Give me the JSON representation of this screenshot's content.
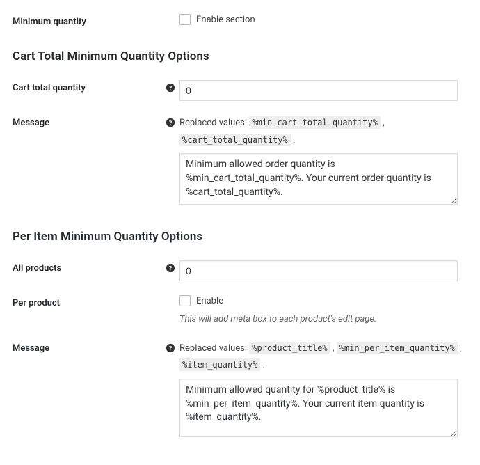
{
  "min_qty": {
    "label": "Minimum quantity",
    "enable_label": "Enable section"
  },
  "cart_section": {
    "heading": "Cart Total Minimum Quantity Options",
    "total_qty": {
      "label": "Cart total quantity",
      "value": "0"
    },
    "message": {
      "label": "Message",
      "replaced_prefix": "Replaced values: ",
      "tokens": [
        "%min_cart_total_quantity%",
        "%cart_total_quantity%"
      ],
      "value": "Minimum allowed order quantity is %min_cart_total_quantity%. Your current order quantity is %cart_total_quantity%."
    }
  },
  "item_section": {
    "heading": "Per Item Minimum Quantity Options",
    "all_products": {
      "label": "All products",
      "value": "0"
    },
    "per_product": {
      "label": "Per product",
      "enable_label": "Enable",
      "note": "This will add meta box to each product's edit page."
    },
    "message": {
      "label": "Message",
      "replaced_prefix": "Replaced values: ",
      "tokens": [
        "%product_title%",
        "%min_per_item_quantity%",
        "%item_quantity%"
      ],
      "value": "Minimum allowed quantity for %product_title% is %min_per_item_quantity%. Your current item quantity is %item_quantity%."
    }
  }
}
